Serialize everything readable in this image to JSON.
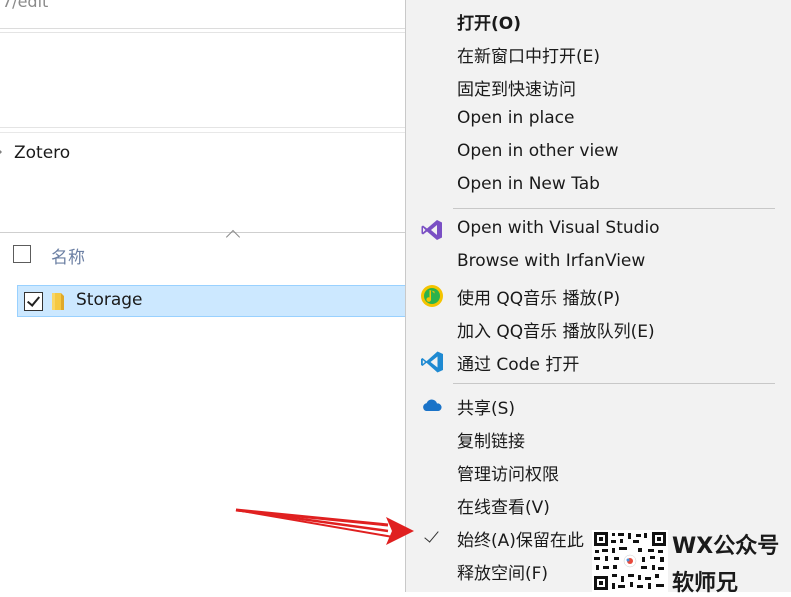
{
  "explorer": {
    "address_fragment": "7/edit",
    "nav_item": "Zotero",
    "column_header": "名称",
    "file": {
      "name": "Storage",
      "checked": true,
      "selected": true
    }
  },
  "context_menu": {
    "items": [
      {
        "label": "打开(O)",
        "bold": true,
        "icon": ""
      },
      {
        "label": "在新窗口中打开(E)",
        "icon": ""
      },
      {
        "label": "固定到快速访问",
        "icon": ""
      },
      {
        "label": "Open in place",
        "icon": ""
      },
      {
        "label": "Open in other view",
        "icon": ""
      },
      {
        "label": "Open in New Tab",
        "icon": ""
      },
      {
        "label": "Open with Visual Studio",
        "icon": "visual-studio-icon"
      },
      {
        "label": "Browse with IrfanView",
        "icon": ""
      },
      {
        "label": "使用 QQ音乐 播放(P)",
        "icon": "qq-music-icon"
      },
      {
        "label": "加入 QQ音乐 播放队列(E)",
        "icon": ""
      },
      {
        "label": "通过 Code 打开",
        "icon": "vscode-icon"
      },
      {
        "label": "共享(S)",
        "icon": "onedrive-cloud-icon"
      },
      {
        "label": "复制链接",
        "icon": ""
      },
      {
        "label": "管理访问权限",
        "icon": ""
      },
      {
        "label": "在线查看(V)",
        "icon": ""
      },
      {
        "label": "始终(A)保留在此",
        "icon": "checkmark-icon",
        "checked": true
      },
      {
        "label": "释放空间(F)",
        "icon": ""
      }
    ]
  },
  "watermark": {
    "line1": "WX公众号",
    "line2": "软师兄"
  },
  "colors": {
    "selection_bg": "#cce8ff",
    "selection_border": "#99d1ff",
    "menu_bg": "#f2f2f2",
    "annotation_arrow": "#e02020",
    "visual_studio": "#7a4fc4",
    "vscode": "#1f8ad2",
    "qq_music": "#f4c400",
    "onedrive": "#1a73c8"
  }
}
